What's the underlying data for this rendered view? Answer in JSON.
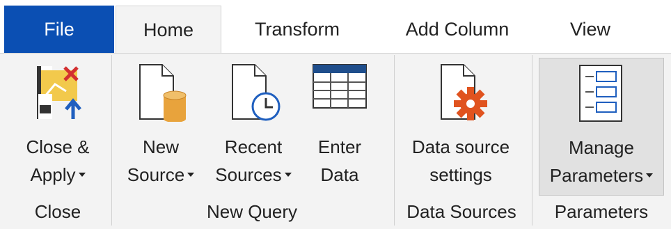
{
  "tabs": [
    {
      "label": "File"
    },
    {
      "label": "Home"
    },
    {
      "label": "Transform"
    },
    {
      "label": "Add Column"
    },
    {
      "label": "View"
    }
  ],
  "groups": {
    "close": {
      "label": "Close",
      "buttons": {
        "close_apply": {
          "line1": "Close &",
          "line2": "Apply",
          "icon": "close-apply-icon"
        }
      }
    },
    "new_query": {
      "label": "New Query",
      "buttons": {
        "new_source": {
          "line1": "New",
          "line2": "Source",
          "icon": "new-source-icon"
        },
        "recent_sources": {
          "line1": "Recent",
          "line2": "Sources",
          "icon": "recent-sources-icon"
        },
        "enter_data": {
          "line1": "Enter",
          "line2": "Data",
          "icon": "enter-data-icon"
        }
      }
    },
    "data_sources": {
      "label": "Data Sources",
      "buttons": {
        "data_source_settings": {
          "line1": "Data source",
          "line2": "settings",
          "icon": "data-source-settings-icon"
        }
      }
    },
    "parameters": {
      "label": "Parameters",
      "buttons": {
        "manage_parameters": {
          "line1": "Manage",
          "line2": "Parameters",
          "icon": "manage-parameters-icon"
        }
      }
    }
  },
  "colors": {
    "file_tab": "#0b4fb3",
    "accent_orange": "#e0531f",
    "cylinder": "#e8a33c",
    "table_header": "#1f4e8c",
    "calendar_blue": "#1f5fbf"
  }
}
